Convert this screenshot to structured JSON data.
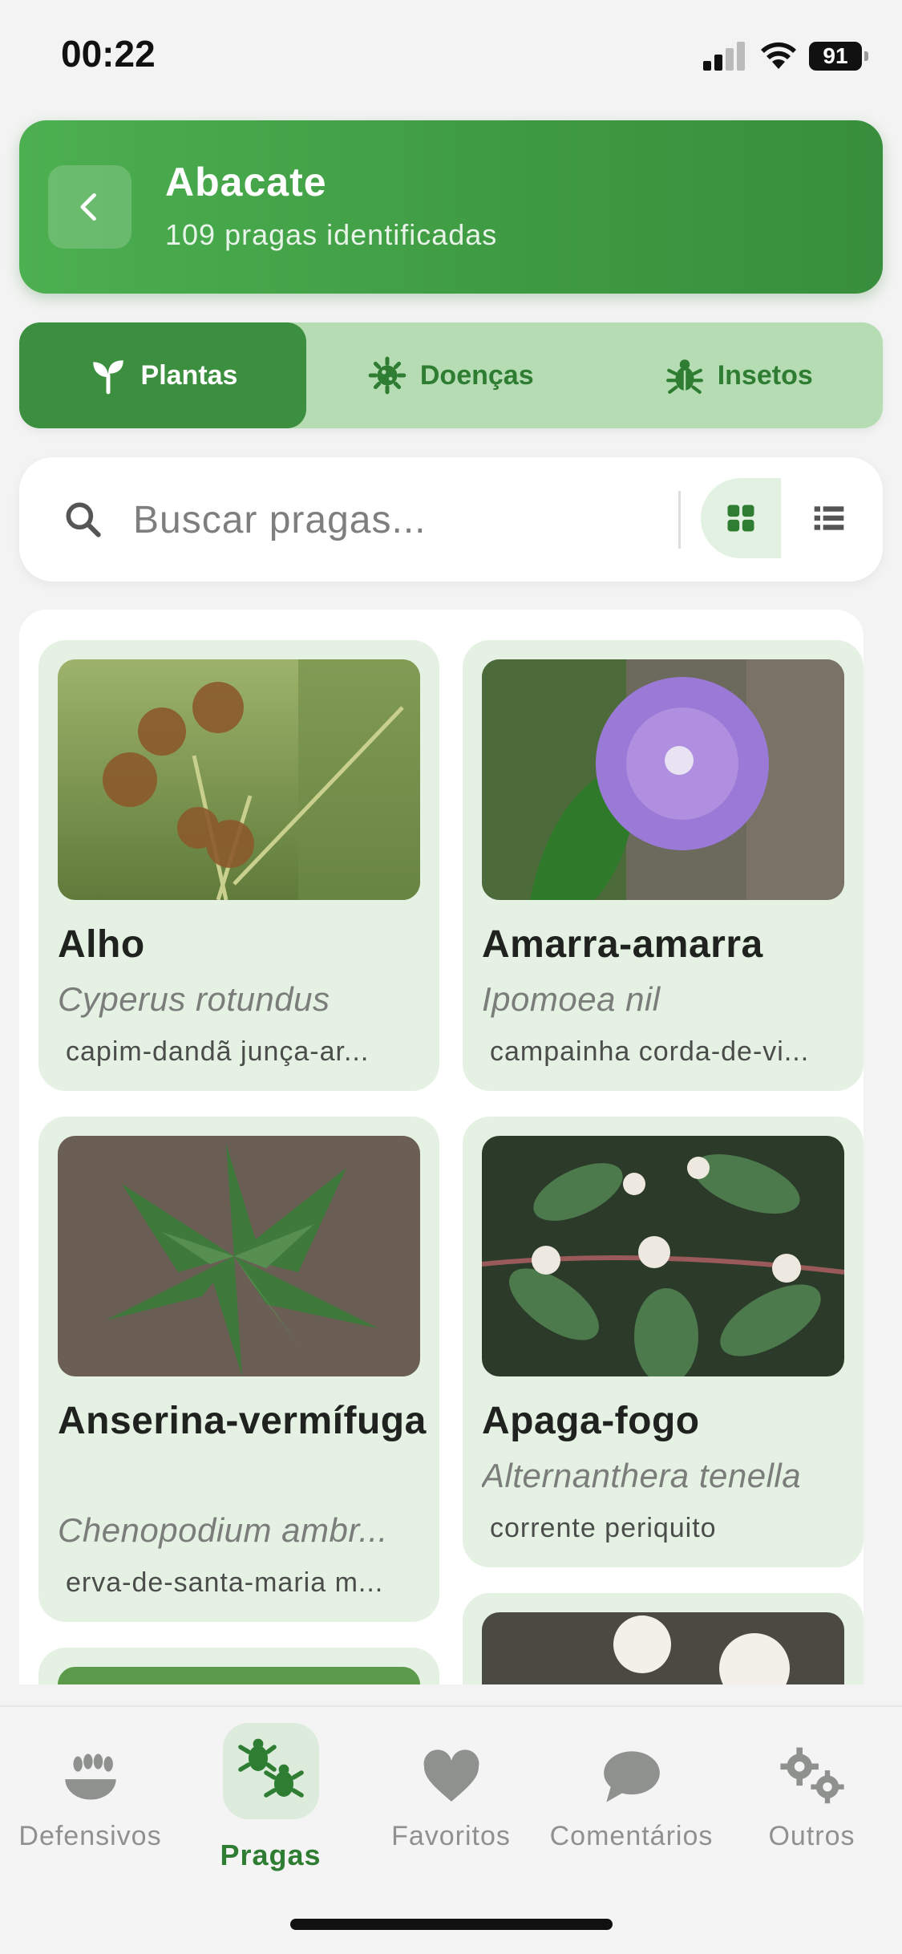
{
  "status": {
    "time": "00:22",
    "battery": "91"
  },
  "header": {
    "title": "Abacate",
    "subtitle": "109 pragas identificadas"
  },
  "segments": [
    {
      "label": "Plantas",
      "icon": "sprout-icon",
      "active": true
    },
    {
      "label": "Doenças",
      "icon": "virus-icon",
      "active": false
    },
    {
      "label": "Insetos",
      "icon": "bug-icon",
      "active": false
    }
  ],
  "search": {
    "placeholder": "Buscar pragas...",
    "value": ""
  },
  "cards": [
    {
      "name": "Alho",
      "scientific": "Cyperus rotundus",
      "common": "capim-dandã junça-ar..."
    },
    {
      "name": "Amarra-amarra",
      "scientific": "Ipomoea nil",
      "common": "campainha corda-de-vi..."
    },
    {
      "name": "Anserina-vermífuga",
      "scientific": "Chenopodium ambr...",
      "common": "erva-de-santa-maria m..."
    },
    {
      "name": "Apaga-fogo",
      "scientific": "Alternanthera tenella",
      "common": "corrente periquito"
    }
  ],
  "tabs": [
    {
      "label": "Defensivos",
      "icon": "bowl-icon"
    },
    {
      "label": "Pragas",
      "icon": "bugs-icon",
      "active": true
    },
    {
      "label": "Favoritos",
      "icon": "heart-icon"
    },
    {
      "label": "Comentários",
      "icon": "chat-icon"
    },
    {
      "label": "Outros",
      "icon": "gears-icon"
    }
  ],
  "colors": {
    "primary": "#388e3c",
    "accent_light": "#e4f1e3",
    "segment_bg": "#b5dcb3"
  }
}
